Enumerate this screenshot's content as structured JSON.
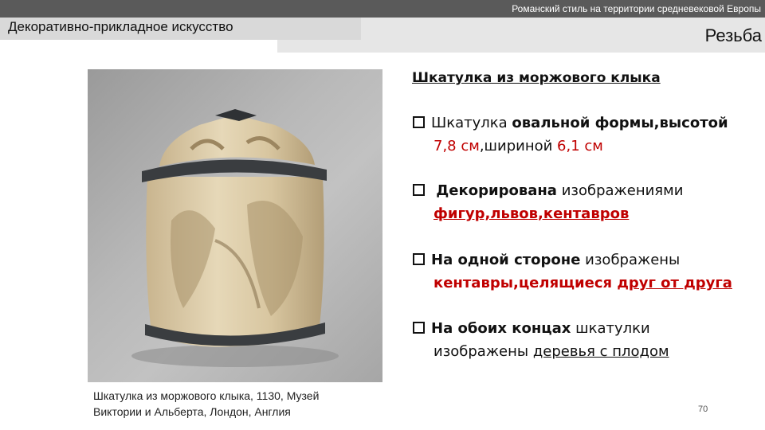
{
  "header": {
    "subtitle": "Романский стиль на территории средневековой Европы",
    "section": "Декоративно-прикладное искусство",
    "topic": "Резьба"
  },
  "photo": {
    "caption_line1": "Шкатулка из моржового клыка, 1130, Музей",
    "caption_line2": "Виктории и Альберта, Лондон, Англия"
  },
  "content": {
    "heading": "Шкатулка из моржового клыка",
    "b1": {
      "a": "Шкатулка ",
      "b": "овальной формы,высотой",
      "c": "7,8 см",
      "d": ",шириной ",
      "e": "6,1 см"
    },
    "b2": {
      "a": " Декорирована",
      "b": " изображениями",
      "c": "фигур,львов,кентавров"
    },
    "b3": {
      "a": "На одной стороне",
      "b": " изображены",
      "c": "кентавры,целящиеся ",
      "d": "друг от друга"
    },
    "b4": {
      "a": "На обоих концах",
      "b": " шкатулки",
      "c": "изображены ",
      "d": "деревья с плодом"
    }
  },
  "page_number": "70",
  "colors": {
    "accent_red": "#c00000",
    "bar_dark": "#5a5a5a",
    "bar_light": "#d9d9d9"
  }
}
